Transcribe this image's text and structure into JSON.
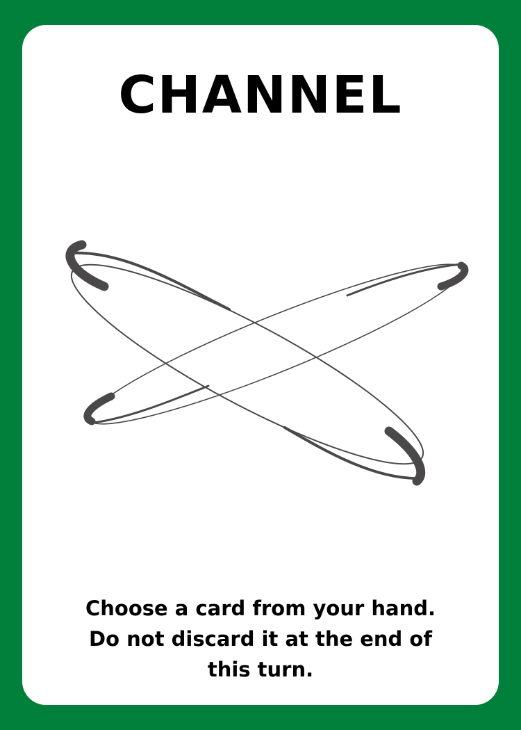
{
  "card": {
    "title": "CHANNEL",
    "description_lines": [
      "Choose a card from your hand.",
      "Do not discard it at the end of",
      "this turn."
    ],
    "art_icon": "crossed-orbits-icon"
  },
  "colors": {
    "border": "#00803a",
    "card_face": "#ffffff",
    "text": "#000000",
    "art_stroke": "#4a4848"
  }
}
